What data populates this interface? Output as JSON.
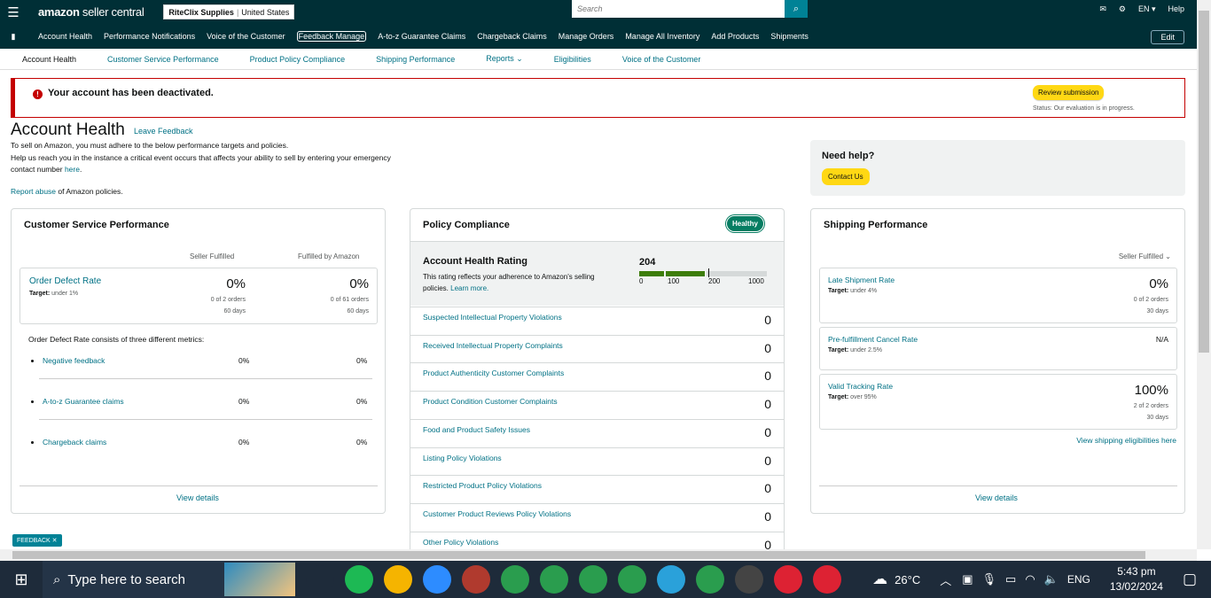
{
  "topbar": {
    "logo_main": "amazon",
    "logo_sub": " seller central",
    "store_name": "RiteClix Supplies",
    "store_market": "United States",
    "search_placeholder": "Search",
    "lang": "EN ▾",
    "help": "Help"
  },
  "nav": {
    "items": [
      "Account Health",
      "Performance Notifications",
      "Voice of the Customer",
      "Feedback Manage",
      "A-to-z Guarantee Claims",
      "Chargeback Claims",
      "Manage Orders",
      "Manage All Inventory",
      "Add Products",
      "Shipments"
    ],
    "edit": "Edit"
  },
  "subtabs": [
    "Account Health",
    "Customer Service Performance",
    "Product Policy Compliance",
    "Shipping Performance",
    "Reports ⌄",
    "Eligibilities",
    "Voice of the Customer"
  ],
  "alert": {
    "message": "Your account has been deactivated.",
    "button": "Review submission",
    "status": "Status: Our evaluation is in progress."
  },
  "page": {
    "title": "Account Health",
    "leave_feedback": "Leave Feedback",
    "intro1": "To sell on Amazon, you must adhere to the below performance targets and policies.",
    "intro2": "Help us reach you in the instance a critical event occurs that affects your ability to sell by entering your emergency contact number ",
    "intro_link": "here",
    "intro_end": ".",
    "report_link": "Report abuse",
    "report_rest": " of Amazon policies."
  },
  "help": {
    "title": "Need help?",
    "button": "Contact Us"
  },
  "csp": {
    "title": "Customer Service Performance",
    "col1": "Seller Fulfilled",
    "col2": "Fulfilled by Amazon",
    "odr_name": "Order Defect Rate",
    "odr_target_label": "Target:",
    "odr_target": " under 1%",
    "odr_v1": "0%",
    "odr_v1_sub": "0 of 2 orders",
    "odr_v1_days": "60 days",
    "odr_v2": "0%",
    "odr_v2_sub": "0 of 61 orders",
    "odr_v2_days": "60 days",
    "consists": "Order Defect Rate consists of three different metrics:",
    "metrics": [
      {
        "name": "Negative feedback",
        "v1": "0%",
        "v2": "0%"
      },
      {
        "name": "A-to-z Guarantee claims",
        "v1": "0%",
        "v2": "0%"
      },
      {
        "name": "Chargeback claims",
        "v1": "0%",
        "v2": "0%"
      }
    ],
    "view": "View details"
  },
  "pc": {
    "title": "Policy Compliance",
    "badge": "Healthy",
    "ahr_title": "Account Health Rating",
    "ahr_desc": "This rating reflects your adherence to Amazon's selling policies. ",
    "ahr_learn": "Learn more.",
    "ahr_value": "204",
    "ahr_fraction": 0.204,
    "ahr_ticks": [
      "0",
      "100",
      "200",
      "1000"
    ],
    "rows": [
      {
        "label": "Suspected Intellectual Property Violations",
        "value": "0"
      },
      {
        "label": "Received Intellectual Property Complaints",
        "value": "0"
      },
      {
        "label": "Product Authenticity Customer Complaints",
        "value": "0"
      },
      {
        "label": "Product Condition Customer Complaints",
        "value": "0"
      },
      {
        "label": "Food and Product Safety Issues",
        "value": "0"
      },
      {
        "label": "Listing Policy Violations",
        "value": "0"
      },
      {
        "label": "Restricted Product Policy Violations",
        "value": "0"
      },
      {
        "label": "Customer Product Reviews Policy Violations",
        "value": "0"
      },
      {
        "label": "Other Policy Violations",
        "value": "0"
      }
    ]
  },
  "sp": {
    "title": "Shipping Performance",
    "filter": "Seller Fulfilled ⌄",
    "metrics": [
      {
        "name": "Late Shipment Rate",
        "target": " under 4%",
        "value": "0%",
        "sub": "0 of 2 orders",
        "days": "30 days"
      },
      {
        "name": "Pre-fulfillment Cancel Rate",
        "target": " under 2.5%",
        "value": "N/A",
        "sub": "",
        "days": ""
      },
      {
        "name": "Valid Tracking Rate",
        "target": " over 95%",
        "value": "100%",
        "sub": "2 of 2 orders",
        "days": "30 days"
      }
    ],
    "target_label": "Target:",
    "elig": "View shipping eligibilities here",
    "view": "View details"
  },
  "feedback_tag": "FEEDBACK ✕",
  "taskbar": {
    "search": "Type here to search",
    "weather": "26°C",
    "lang": "ENG",
    "time": "5:43 pm",
    "date": "13/02/2024",
    "apps": [
      "task-view",
      "spotify",
      "folder",
      "zoom",
      "snip",
      "chrome-m",
      "chrome-h",
      "chrome-l",
      "chrome-m2",
      "telegram",
      "chrome-m3",
      "calculator",
      "chrome-s",
      "chrome-r"
    ]
  }
}
